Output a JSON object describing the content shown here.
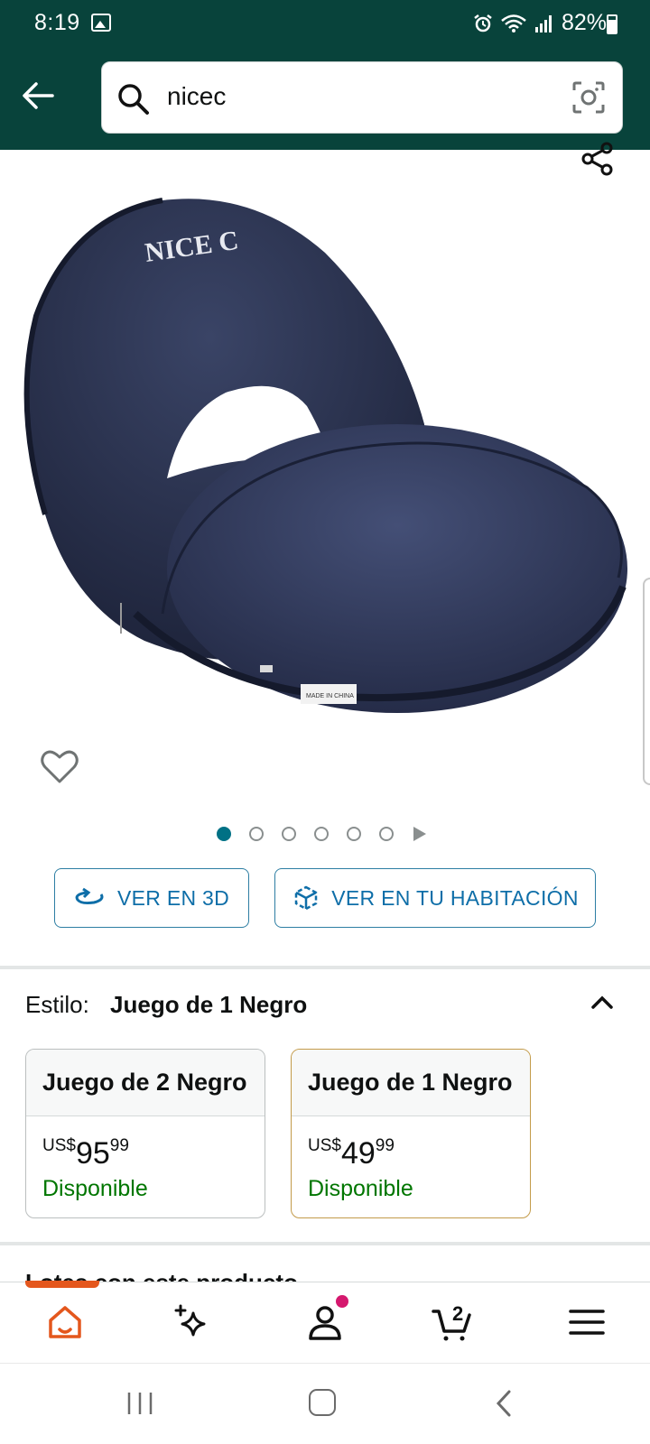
{
  "status_bar": {
    "time": "8:19",
    "battery": "82%"
  },
  "search": {
    "query": "nicec"
  },
  "product": {
    "brand_text": "NICE C",
    "label_text": "MADE IN CHINA",
    "carousel": {
      "total_images": 6,
      "active_index": 0
    }
  },
  "buttons": {
    "view_3d": "VER EN 3D",
    "view_room": "VER EN TU HABITACIÓN"
  },
  "style_selector": {
    "label": "Estilo:",
    "selected": "Juego de 1 Negro",
    "options": [
      {
        "name": "Juego de 2 Negro",
        "currency": "US$",
        "whole": "95",
        "cents": "99",
        "availability": "Disponible",
        "selected": false
      },
      {
        "name": "Juego de 1 Negro",
        "currency": "US$",
        "whole": "49",
        "cents": "99",
        "availability": "Disponible",
        "selected": true
      }
    ]
  },
  "next_section_peek": "Lotes con este producto",
  "bottom_nav": {
    "cart_count": "2"
  },
  "colors": {
    "header": "#08433b",
    "accent": "#e4571d",
    "link": "#0e6ea8",
    "available": "#007600",
    "selected_border": "#c39b4a"
  }
}
